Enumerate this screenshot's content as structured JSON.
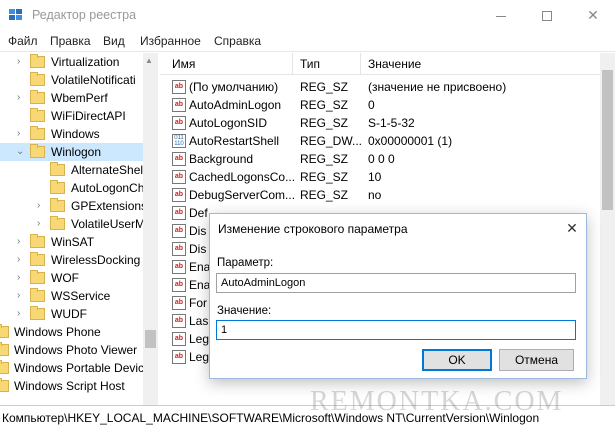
{
  "window": {
    "title": "Редактор реестра",
    "icon": "regedit-icon",
    "minimize_glyph": "minimize-icon",
    "maximize_glyph": "maximize-icon",
    "close_glyph": "✕"
  },
  "menu": [
    "Файл",
    "Правка",
    "Вид",
    "Избранное",
    "Справка"
  ],
  "tree": {
    "items": [
      {
        "label": "Virtualization",
        "expanded": false
      },
      {
        "label": "VolatileNotificati",
        "expanded": false
      },
      {
        "label": "WbemPerf",
        "expanded": false
      },
      {
        "label": "WiFiDirectAPI",
        "expanded": false
      },
      {
        "label": "Windows",
        "expanded": false
      },
      {
        "label": "Winlogon",
        "expanded": true,
        "selected": true
      },
      {
        "label": "AlternateShel"
      },
      {
        "label": "AutoLogonCh"
      },
      {
        "label": "GPExtensions"
      },
      {
        "label": "VolatileUserM"
      },
      {
        "label": "WinSAT"
      },
      {
        "label": "WirelessDocking"
      },
      {
        "label": "WOF"
      },
      {
        "label": "WSService"
      },
      {
        "label": "WUDF"
      },
      {
        "label": "Windows Phone"
      },
      {
        "label": "Windows Photo Viewer"
      },
      {
        "label": "Windows Portable Devic"
      },
      {
        "label": "Windows Script Host"
      }
    ]
  },
  "list": {
    "columns": {
      "name": "Имя",
      "type": "Тип",
      "value": "Значение"
    },
    "rows": [
      {
        "icon": "string-value-icon",
        "name": "(По умолчанию)",
        "type": "REG_SZ",
        "value": "(значение не присвоено)"
      },
      {
        "icon": "string-value-icon",
        "name": "AutoAdminLogon",
        "type": "REG_SZ",
        "value": "0"
      },
      {
        "icon": "string-value-icon",
        "name": "AutoLogonSID",
        "type": "REG_SZ",
        "value": "S-1-5-32"
      },
      {
        "icon": "binary-value-icon",
        "name": "AutoRestartShell",
        "type": "REG_DW...",
        "value": "0x00000001 (1)"
      },
      {
        "icon": "string-value-icon",
        "name": "Background",
        "type": "REG_SZ",
        "value": "0 0 0"
      },
      {
        "icon": "string-value-icon",
        "name": "CachedLogonsCo...",
        "type": "REG_SZ",
        "value": "10"
      },
      {
        "icon": "string-value-icon",
        "name": "DebugServerCom...",
        "type": "REG_SZ",
        "value": "no"
      },
      {
        "icon": "string-value-icon",
        "name": "Def",
        "type": "",
        "value": ""
      },
      {
        "icon": "string-value-icon",
        "name": "Dis",
        "type": "",
        "value": ""
      },
      {
        "icon": "string-value-icon",
        "name": "Dis",
        "type": "",
        "value": ""
      },
      {
        "icon": "string-value-icon",
        "name": "Ena",
        "type": "",
        "value": ""
      },
      {
        "icon": "string-value-icon",
        "name": "Ena",
        "type": "",
        "value": ""
      },
      {
        "icon": "string-value-icon",
        "name": "For",
        "type": "",
        "value": ""
      },
      {
        "icon": "string-value-icon",
        "name": "Las",
        "type": "",
        "value": ""
      },
      {
        "icon": "string-value-icon",
        "name": "Leg",
        "type": "",
        "value": ""
      },
      {
        "icon": "string-value-icon",
        "name": "Leg",
        "type": "",
        "value": ""
      }
    ]
  },
  "status": {
    "path": "Компьютер\\HKEY_LOCAL_MACHINE\\SOFTWARE\\Microsoft\\Windows NT\\CurrentVersion\\Winlogon"
  },
  "watermark": "REMONTKA.COM",
  "dialog": {
    "title": "Изменение строкового параметра",
    "param_label": "Параметр:",
    "param_value": "AutoAdminLogon",
    "value_label": "Значение:",
    "value_value": "1",
    "ok_label": "OK",
    "cancel_label": "Отмена"
  },
  "colors": {
    "accent": "#0078d7",
    "selection": "#cce8ff",
    "folder": "#f8d775"
  }
}
